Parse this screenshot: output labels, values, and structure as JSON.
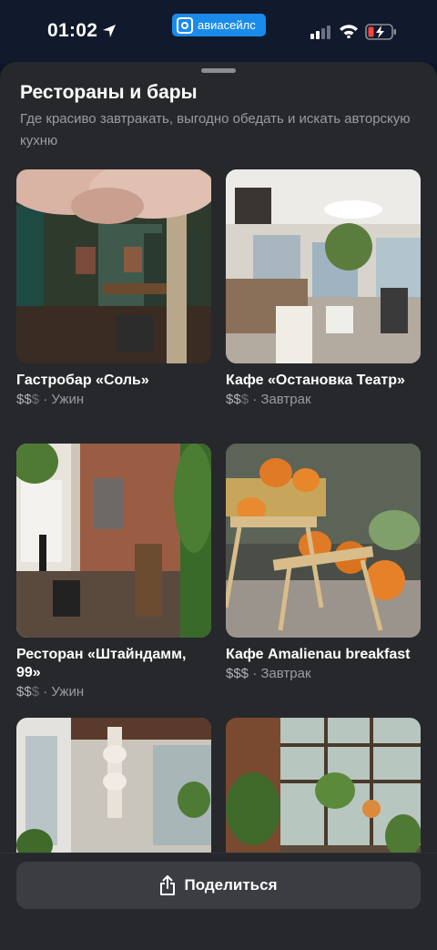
{
  "status_bar": {
    "time": "01:02",
    "app_badge": "авиасейлс"
  },
  "sheet": {
    "title": "Рестораны и бары",
    "subtitle": "Где красиво завтракать, выгодно обедать и искать авторскую кухню"
  },
  "cards": [
    {
      "name": "Гастробар «Соль»",
      "price_active": "$$",
      "price_inactive": "$",
      "separator": " · ",
      "meal": "Ужин"
    },
    {
      "name": "Кафе «Остановка Театр»",
      "price_active": "$$",
      "price_inactive": "$",
      "separator": " · ",
      "meal": "Завтрак"
    },
    {
      "name": "Ресторан «Штайндамм, 99»",
      "price_active": "$$",
      "price_inactive": "$",
      "separator": " · ",
      "meal": "Ужин"
    },
    {
      "name": "Кафе Amalienau breakfast",
      "price_active": "$$$",
      "price_inactive": "",
      "separator": " · ",
      "meal": "Завтрак"
    }
  ],
  "share_button": {
    "label": "Поделиться"
  },
  "colors": {
    "background": "#0e1626",
    "sheet": "#26282c",
    "badge": "#1a8bea",
    "button": "#3b3d42",
    "muted_text": "#9a9ca1"
  },
  "icons": [
    "location-arrow-icon",
    "aviasales-logo-icon",
    "cellular-signal-icon",
    "wifi-icon",
    "battery-charging-icon",
    "share-icon"
  ]
}
